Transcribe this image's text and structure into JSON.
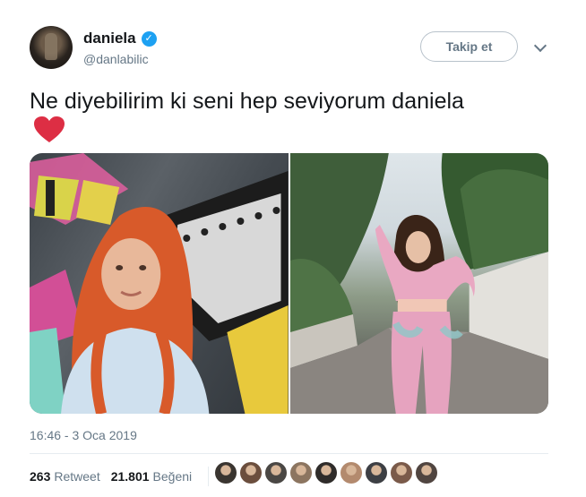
{
  "user": {
    "display_name": "daniela",
    "handle": "@danlabilic",
    "verified_mark": "✓",
    "verified_color": "#1da1f2"
  },
  "follow_button": {
    "label": "Takip et"
  },
  "tweet": {
    "text": "Ne diyebilirim ki seni hep seviyorum daniela",
    "emoji": "red-heart",
    "heart_color": "#dd2e44"
  },
  "meta": {
    "timestamp": "16:46 - 3 Oca 2019"
  },
  "stats": {
    "retweets_count": "263",
    "retweets_label": "Retweet",
    "likes_count": "21.801",
    "likes_label": "Beğeni"
  },
  "likers": {
    "avatars": [
      "#3a3530",
      "#6b4e3d",
      "#4a4744",
      "#8c7560",
      "#2f2c2a",
      "#b38a6e",
      "#3d3f44",
      "#7a5a4a",
      "#504540"
    ]
  },
  "icons": {
    "more": "chevron-down-icon",
    "verified": "verified-badge-icon"
  }
}
